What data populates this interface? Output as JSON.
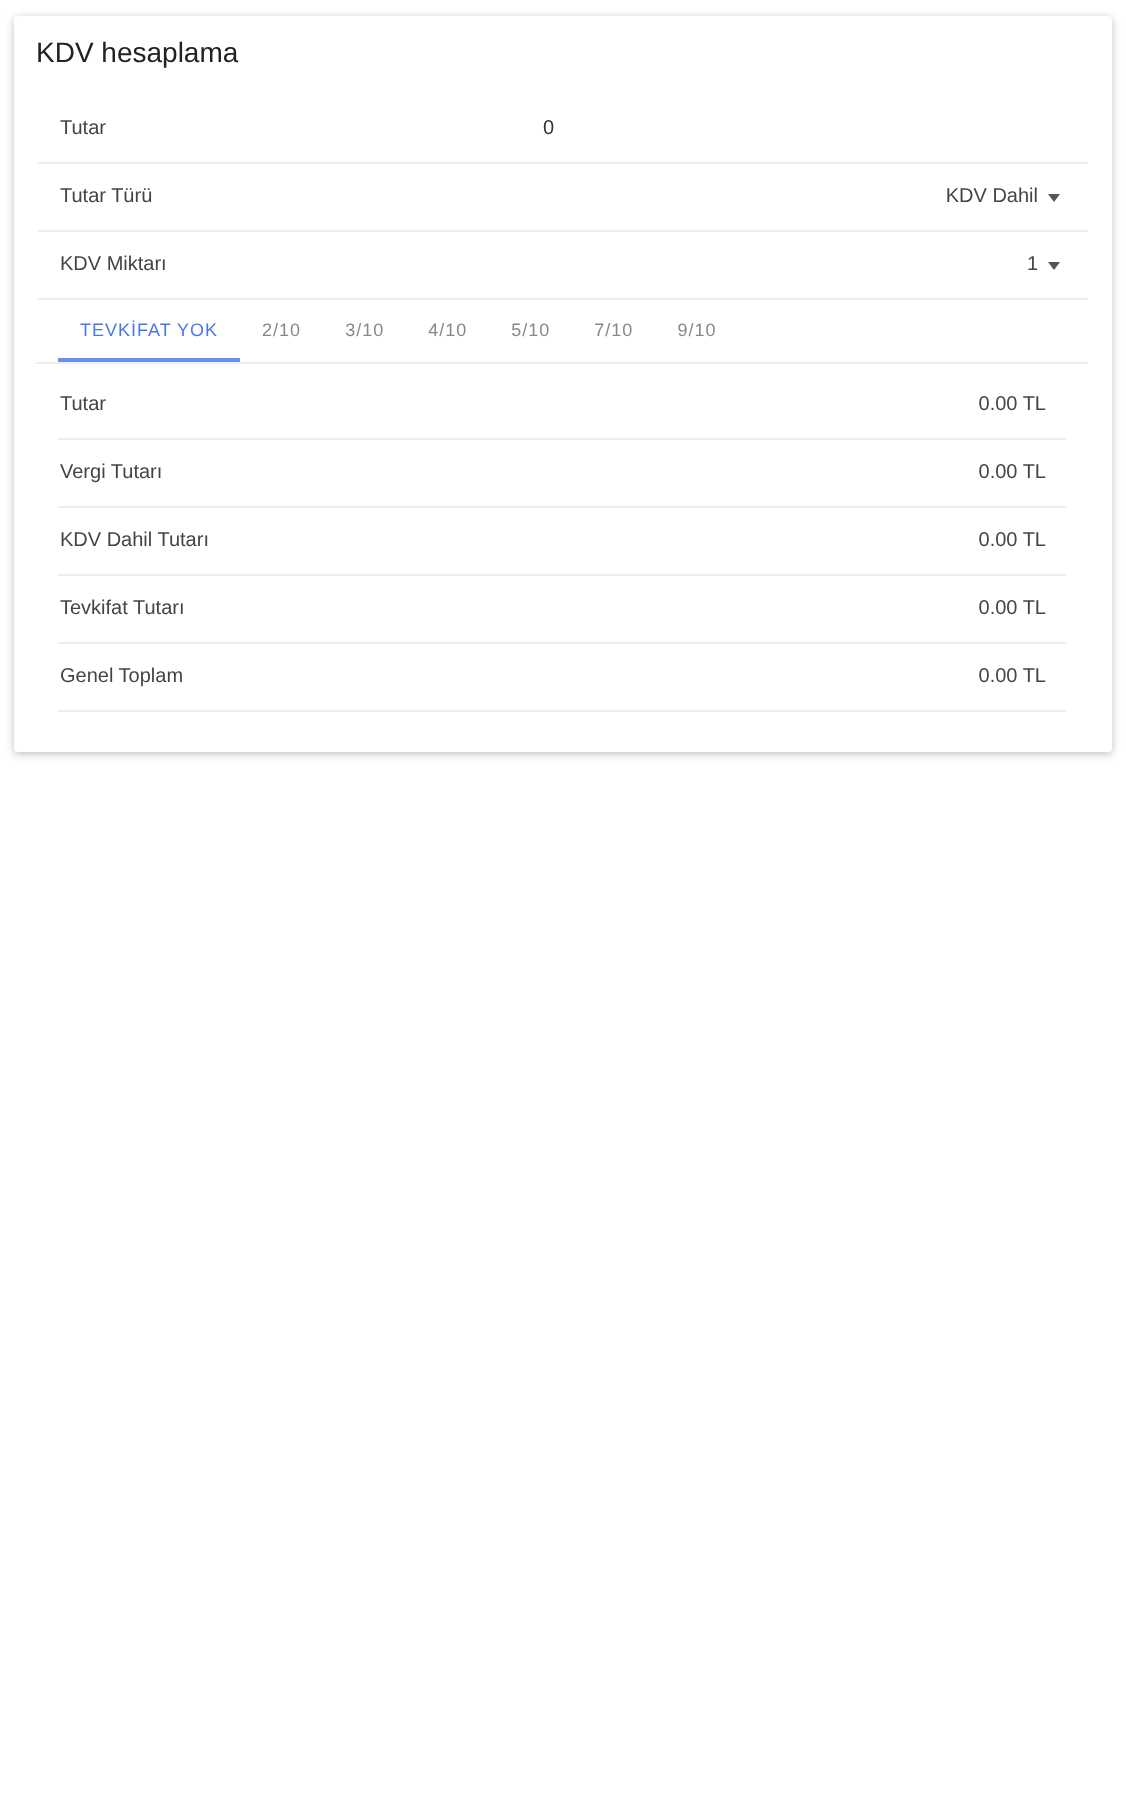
{
  "card": {
    "title": "KDV hesaplama"
  },
  "inputs": [
    {
      "kind": "text",
      "label": "Tutar",
      "value": "0"
    },
    {
      "kind": "select",
      "label": "Tutar Türü",
      "value": "KDV Dahil"
    },
    {
      "kind": "select",
      "label": "KDV Miktarı",
      "value": "1"
    }
  ],
  "tabs": [
    {
      "label": "TEVKİFAT YOK",
      "selected": true
    },
    {
      "label": "2/10",
      "selected": false
    },
    {
      "label": "3/10",
      "selected": false
    },
    {
      "label": "4/10",
      "selected": false
    },
    {
      "label": "5/10",
      "selected": false
    },
    {
      "label": "7/10",
      "selected": false
    },
    {
      "label": "9/10",
      "selected": false
    }
  ],
  "results": [
    {
      "label": "Tutar",
      "value": "0.00 TL"
    },
    {
      "label": "Vergi Tutarı",
      "value": "0.00 TL"
    },
    {
      "label": "KDV Dahil Tutarı",
      "value": "0.00 TL"
    },
    {
      "label": "Tevkifat Tutarı",
      "value": "0.00 TL"
    },
    {
      "label": "Genel Toplam",
      "value": "0.00 TL"
    }
  ]
}
